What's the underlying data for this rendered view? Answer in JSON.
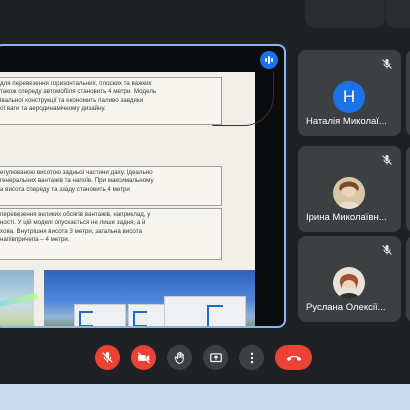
{
  "slide": {
    "block1": "для перевезення горизонтальних, плоских та важких\nтакож спереду автомобіля становить 4 метри. Модель\nівальної конструкції та економить паливо завдяки\nої ваги та аеродинамічному дизайну.",
    "block2": "егулюваною висотою задньої частини даху. Ідеально\nгенеральних вантажів та напоїв. При максимальному\nа висота спереду та ззаду становить 4 метри",
    "block3": "перевезення великих обсягів вантажів, наприклад, у\nності. У цій моделі опускається не лише задня, а й\nхова. Внутрішня висота 3 метри, загальна висота\nнапівпричепа – 4 метри."
  },
  "participants": [
    {
      "name": "Наталія Миколаї...",
      "initial": "Н",
      "muted": true
    },
    {
      "name": "Ірина Миколаївн...",
      "muted": true
    },
    {
      "name": "Руслана Олексії...",
      "muted": true
    }
  ],
  "controls": {
    "mic": "mic-off-icon",
    "camera": "camera-off-icon",
    "raise_hand": "raise-hand-icon",
    "present": "present-screen-icon",
    "more": "more-vert-icon",
    "end_call": "end-call-icon"
  },
  "colors": {
    "accent": "#8ab4f8",
    "danger": "#ea4335",
    "tile": "#3c4043",
    "background": "#1f2125"
  }
}
